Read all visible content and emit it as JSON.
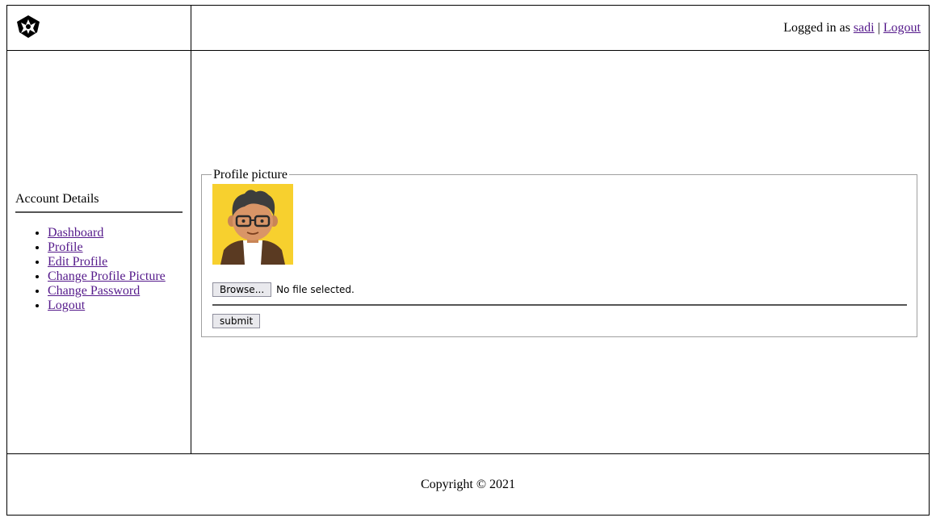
{
  "header": {
    "logo_icon": "shield-eagle-logo",
    "logged_in_prefix": "Logged in as ",
    "username": "sadi",
    "separator": " | ",
    "logout_label": "Logout"
  },
  "sidebar": {
    "heading": "Account Details",
    "items": [
      {
        "label": "Dashboard"
      },
      {
        "label": "Profile"
      },
      {
        "label": "Edit Profile"
      },
      {
        "label": "Change Profile Picture"
      },
      {
        "label": "Change Password"
      },
      {
        "label": "Logout"
      }
    ]
  },
  "main": {
    "legend": "Profile picture",
    "avatar_icon": "user-avatar",
    "browse_label": "Browse...",
    "file_status": "No file selected.",
    "submit_label": "submit"
  },
  "footer": {
    "copyright": "Copyright © 2021"
  },
  "colors": {
    "link": "#551a8b",
    "avatar_bg": "#f7d02e"
  }
}
